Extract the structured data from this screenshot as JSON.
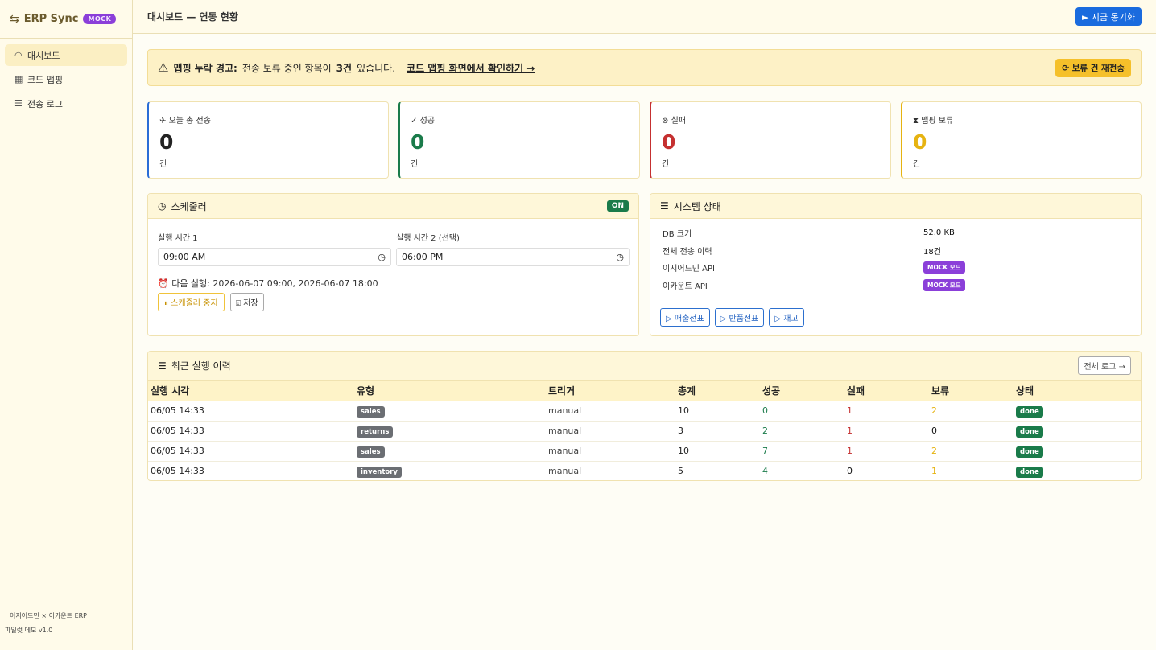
{
  "app": {
    "logo_icon": "⇆",
    "name": "ERP Sync",
    "mode_badge": "MOCK"
  },
  "sidebar": {
    "items": [
      {
        "icon": "◠",
        "label": "대시보드"
      },
      {
        "icon": "▦",
        "label": "코드 맵핑"
      },
      {
        "icon": "☰",
        "label": "전송 로그"
      }
    ],
    "footer_line1": "이지어드민 × 이카운트 ERP",
    "footer_line2": "파일럿 데모 v1.0"
  },
  "header": {
    "title": "대시보드 — 연동 현황",
    "sync_button": "► 지금 동기화"
  },
  "alert": {
    "icon": "⚠",
    "label": "맵핑 누락 경고:",
    "text_before": "전송 보류 중인 항목이",
    "count": "3건",
    "text_after": "있습니다.",
    "link": "코드 맵핑 화면에서 확인하기 →",
    "retry_button": "⟳ 보류 건 재전송"
  },
  "stats": [
    {
      "icon": "✈",
      "label": "오늘 총 전송",
      "value": "0",
      "unit": "건",
      "color": "#222222",
      "accent": "#2a6dd6"
    },
    {
      "icon": "✓",
      "label": "성공",
      "value": "0",
      "unit": "건",
      "color": "#1a7b4a",
      "accent": "#1a7b4a"
    },
    {
      "icon": "⊗",
      "label": "실패",
      "value": "0",
      "unit": "건",
      "color": "#c53030",
      "accent": "#c53030"
    },
    {
      "icon": "⧗",
      "label": "맵핑 보류",
      "value": "0",
      "unit": "건",
      "color": "#e6b311",
      "accent": "#e6b311"
    }
  ],
  "scheduler": {
    "title": "스케줄러",
    "icon": "◷",
    "status": "ON",
    "time1_label": "실행 시간 1",
    "time1_value": "09:00  AM",
    "time2_label": "실행 시간 2 (선택)",
    "time2_value": "06:00  PM",
    "next_run": "⏰ 다음 실행: 2026-06-07 09:00, 2026-06-07 18:00",
    "stop_button": "⏸ 스케줄러 중지",
    "save_button": "⍗ 저장"
  },
  "system": {
    "title": "시스템 상태",
    "icon": "☰",
    "rows": [
      {
        "key": "DB 크기",
        "value": "52.0 KB"
      },
      {
        "key": "전체 전송 이력",
        "value": "18건"
      },
      {
        "key": "이지어드민 API",
        "value": "MOCK 모드"
      },
      {
        "key": "이카운트 API",
        "value": "MOCK 모드"
      }
    ],
    "buttons": [
      "▷ 매출전표",
      "▷ 반품전표",
      "▷ 재고"
    ]
  },
  "recent": {
    "title": "최근 실행 이력",
    "icon": "☰",
    "all_logs_button": "전체 로그 →",
    "columns": [
      "실행 시각",
      "유형",
      "트리거",
      "총계",
      "성공",
      "실패",
      "보류",
      "상태"
    ],
    "rows": [
      {
        "time": "06/05 14:33",
        "type": "sales",
        "trigger": "manual",
        "total": "10",
        "success": "0",
        "fail": "1",
        "hold": "2",
        "status": "done"
      },
      {
        "time": "06/05 14:33",
        "type": "returns",
        "trigger": "manual",
        "total": "3",
        "success": "2",
        "fail": "1",
        "hold": "0",
        "status": "done"
      },
      {
        "time": "06/05 14:33",
        "type": "sales",
        "trigger": "manual",
        "total": "10",
        "success": "7",
        "fail": "1",
        "hold": "2",
        "status": "done"
      },
      {
        "time": "06/05 14:33",
        "type": "inventory",
        "trigger": "manual",
        "total": "5",
        "success": "4",
        "fail": "0",
        "hold": "1",
        "status": "done"
      }
    ],
    "colors": {
      "success": "#1a7b4a",
      "fail": "#c53030",
      "hold": "#e6b311",
      "zero": "#111111"
    }
  }
}
